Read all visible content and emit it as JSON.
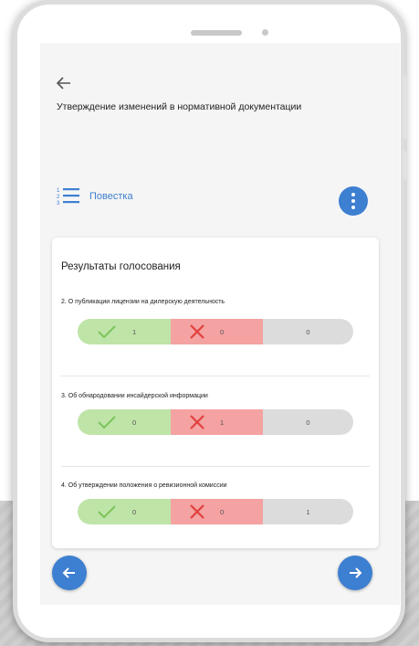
{
  "header": {
    "back_icon": "arrow-left-icon",
    "title": "Утверждение изменений в нормативной документации"
  },
  "agenda": {
    "icon": "numbered-list-icon",
    "label": "Повестка",
    "menu_icon": "more-vertical-icon"
  },
  "results": {
    "title": "Результаты голосования",
    "items": [
      {
        "question": "2. О публикации лицензии на дилерскую деятельность",
        "yes": "1",
        "no": "0",
        "abstain": "0"
      },
      {
        "question": "3. Об обнародовании инсайдерской информации",
        "yes": "0",
        "no": "1",
        "abstain": "0"
      },
      {
        "question": "4. Об утверждении положения о ревизионной комиссии",
        "yes": "0",
        "no": "0",
        "abstain": "1"
      }
    ]
  },
  "nav": {
    "prev_icon": "arrow-left-icon",
    "next_icon": "arrow-right-icon"
  },
  "colors": {
    "accent": "#3d7fd1",
    "yes": "#bfe4a8",
    "no": "#f4a2a2",
    "abstain": "#dcdcdc"
  }
}
